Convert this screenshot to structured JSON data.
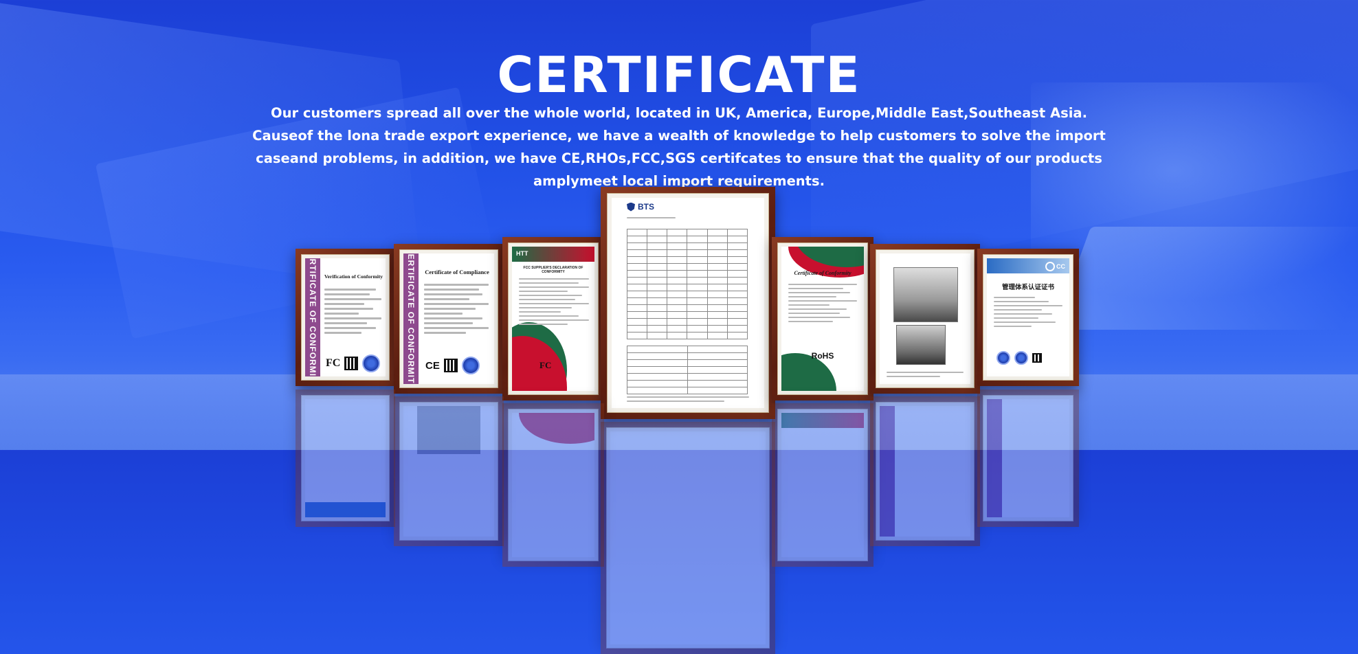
{
  "page": {
    "title": "CERTIFICATE",
    "description": "Our customers spread all over the whole world, located in UK, America, Europe,Middle East,Southeast Asia. Causeof the lona trade export experience, we have a wealth of knowledge to help customers to solve the import caseand problems, in addition, we have CE,RHOs,FCC,SGS certifcates to ensure that the quality of our products amplymeet local import requirements."
  },
  "certificates": {
    "c1": {
      "stripe": "CERTIFICATE OF CONFORMITY",
      "heading": "Verification of Conformity",
      "logo": "FC"
    },
    "c2": {
      "stripe": "CERTIFICATE OF CONFORMITY",
      "heading": "Certificate of Compliance",
      "logo": "CE"
    },
    "c3": {
      "brand": "HTT",
      "heading": "FCC SUPPLIER'S DECLARATION OF CONFORMITY",
      "logo": "FC"
    },
    "c4": {
      "brand": "BTS"
    },
    "c5": {
      "heading": "Certificate of Conformity",
      "mark": "RoHS"
    },
    "c6": {},
    "c7": {
      "brand": "CC",
      "heading": "管理体系认证证书"
    }
  },
  "colors": {
    "background": "#2150e6",
    "frame": "#6e2a17",
    "stripe_purple": "#8e4a8e",
    "stripe_teal": "#1f6f6a",
    "accent_red": "#c8102e",
    "accent_green": "#1e6b45"
  }
}
